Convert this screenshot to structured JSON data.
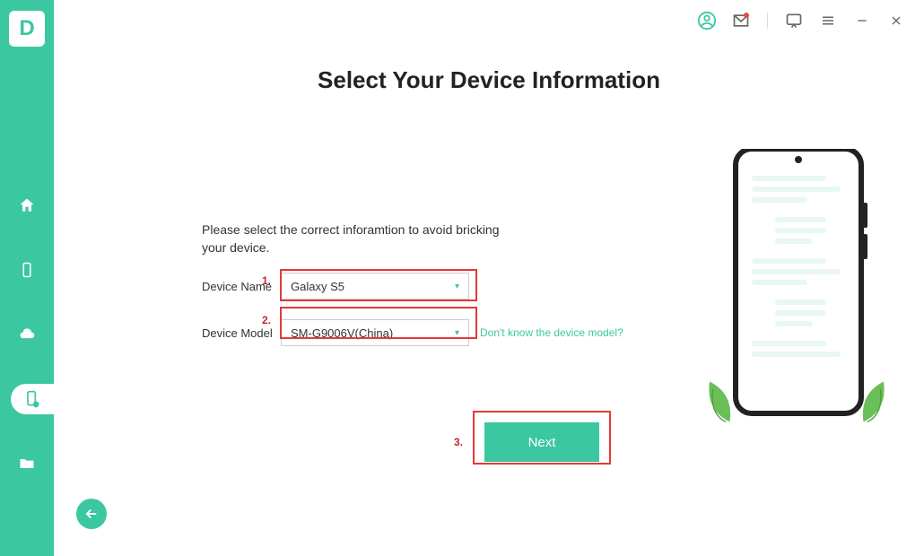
{
  "app": {
    "logo_letter": "D"
  },
  "title": "Select Your Device Information",
  "instruction": "Please select the correct inforamtion to avoid bricking your device.",
  "form": {
    "device_name_label": "Device Name",
    "device_name_value": "Galaxy S5",
    "device_model_label": "Device Model",
    "device_model_value": "SM-G9006V(China)",
    "help_link": "Don't know the device model?"
  },
  "buttons": {
    "next": "Next"
  },
  "annotations": {
    "one": "1.",
    "two": "2.",
    "three": "3."
  },
  "colors": {
    "accent": "#3bc7a0",
    "highlight": "#e53935"
  }
}
